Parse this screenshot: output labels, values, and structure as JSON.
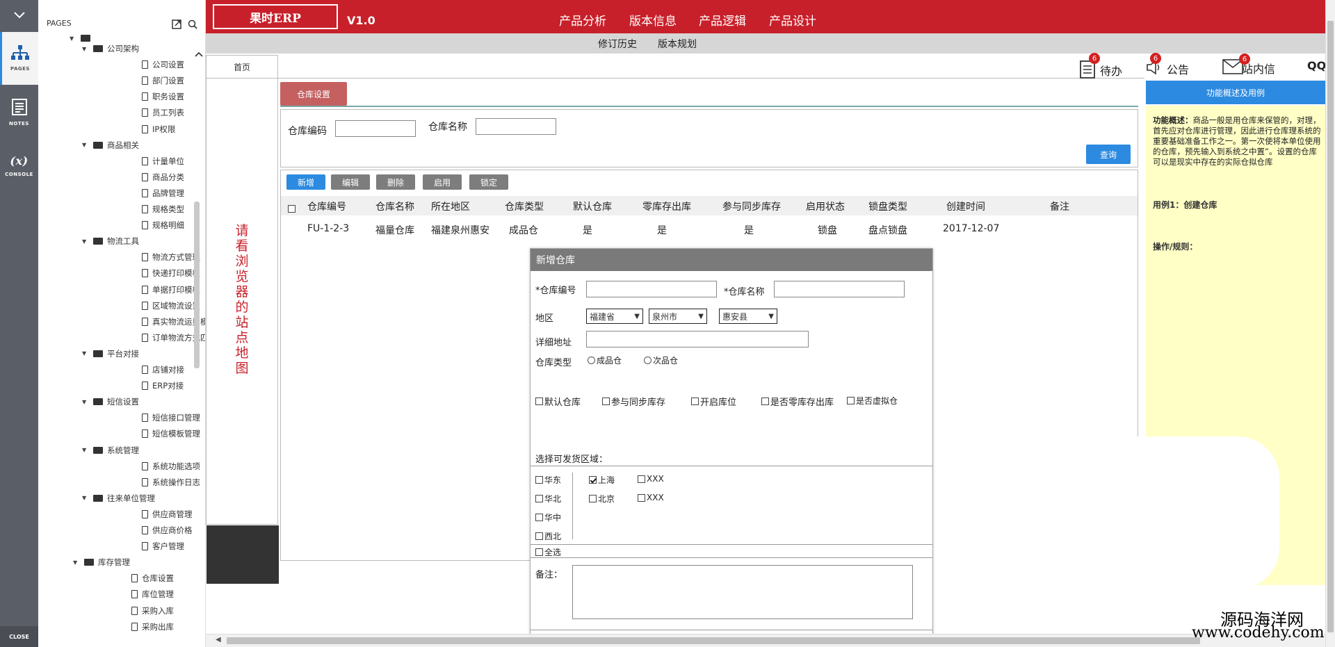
{
  "rail": {
    "pages_label": "PAGES",
    "notes_label": "NOTES",
    "console_label": "CONSOLE",
    "console_symbol": "(x)",
    "close_label": "CLOSE"
  },
  "tree": {
    "header": "PAGES",
    "groups": [
      {
        "label": "公司架构",
        "items": [
          "公司设置",
          "部门设置",
          "职务设置",
          "员工列表",
          "IP权限"
        ]
      },
      {
        "label": "商品相关",
        "items": [
          "计量单位",
          "商品分类",
          "品牌管理",
          "规格类型",
          "规格明细"
        ]
      },
      {
        "label": "物流工具",
        "items": [
          "物流方式管理",
          "快递打印模板",
          "单据打印模板",
          "区域物流设置",
          "真实物流运费模板",
          "订单物流方式匹配（"
        ]
      },
      {
        "label": "平台对接",
        "items": [
          "店铺对接",
          "ERP对接"
        ]
      },
      {
        "label": "短信设置",
        "items": [
          "短信接口管理",
          "短信模板管理"
        ]
      },
      {
        "label": "系统管理",
        "items": [
          "系统功能选项",
          "系统操作日志"
        ]
      },
      {
        "label": "往来单位管理",
        "items": [
          "供应商管理",
          "供应商价格",
          "客户管理"
        ]
      }
    ],
    "stock_group": {
      "label": "库存管理",
      "items": [
        "仓库设置",
        "库位管理",
        "采购入库",
        "采购出库"
      ]
    }
  },
  "topbar": {
    "logo": "果时ERP",
    "version": "V1.0",
    "nav": [
      "产品分析",
      "版本信息",
      "产品逻辑",
      "产品设计"
    ],
    "subnav": [
      "修订历史",
      "版本规划"
    ],
    "color": "#c8202a"
  },
  "header": {
    "home": "首页",
    "todo": {
      "label": "待办",
      "count": "6"
    },
    "notice": {
      "label": "公告",
      "count": "6"
    },
    "message": {
      "label": "站内信",
      "count": "6"
    },
    "qq": "QQ"
  },
  "sitemap": {
    "text": "请看浏览器的站点地图"
  },
  "page": {
    "tab": "仓库设置",
    "search": {
      "code_label": "仓库编码",
      "name_label": "仓库名称",
      "query_btn": "查询"
    },
    "toolbar": {
      "add": "新增",
      "edit": "编辑",
      "delete": "删除",
      "enable": "启用",
      "lock": "锁定"
    },
    "columns": [
      "仓库编号",
      "仓库名称",
      "所在地区",
      "仓库类型",
      "默认仓库",
      "零库存出库",
      "参与同步库存",
      "启用状态",
      "锁盘类型",
      "创建时间",
      "备注"
    ],
    "rows": [
      [
        "FU-1-2-3",
        "福量仓库",
        "福建泉州惠安",
        "成品仓",
        "是",
        "是",
        "是",
        "锁盘",
        "盘点锁盘",
        "2017-12-07",
        ""
      ]
    ]
  },
  "help": {
    "header": "功能概述及用例",
    "overview_title": "功能概述：",
    "overview_text": "商品一般是用仓库来保管的，对理，首先应对仓库进行管理，因此进行仓库理系统的重要基础准备工作之一。第一次使将本单位使用的仓库，预先输入到系统之中置”。设置的仓库可以是现实中存在的实际仓拟仓库",
    "usecase1": "用例1：创建仓库",
    "rules": "操作/规则："
  },
  "modal": {
    "title": "新增仓库",
    "code_label": "*仓库编号",
    "name_label": "*仓库名称",
    "region_label": "地区",
    "province": "福建省",
    "city": "泉州市",
    "county": "惠安县",
    "address_label": "详细地址",
    "type_label": "仓库类型",
    "type_options": [
      "成品仓",
      "次品仓"
    ],
    "flags": [
      "默认仓库",
      "参与同步库存",
      "开启库位",
      "是否零库存出库",
      "是否虚拟仓"
    ],
    "area_label": "选择可发货区域：",
    "regions": [
      "华东",
      "华北",
      "华中",
      "西北"
    ],
    "cities": [
      {
        "label": "上海",
        "checked": true
      },
      {
        "label": "北京",
        "checked": false
      }
    ],
    "others": [
      "XXX",
      "XXX"
    ],
    "select_all": "全选",
    "remark_label": "备注："
  },
  "watermark": {
    "line1": "源码海洋网",
    "line2": "www.codehy.com"
  }
}
